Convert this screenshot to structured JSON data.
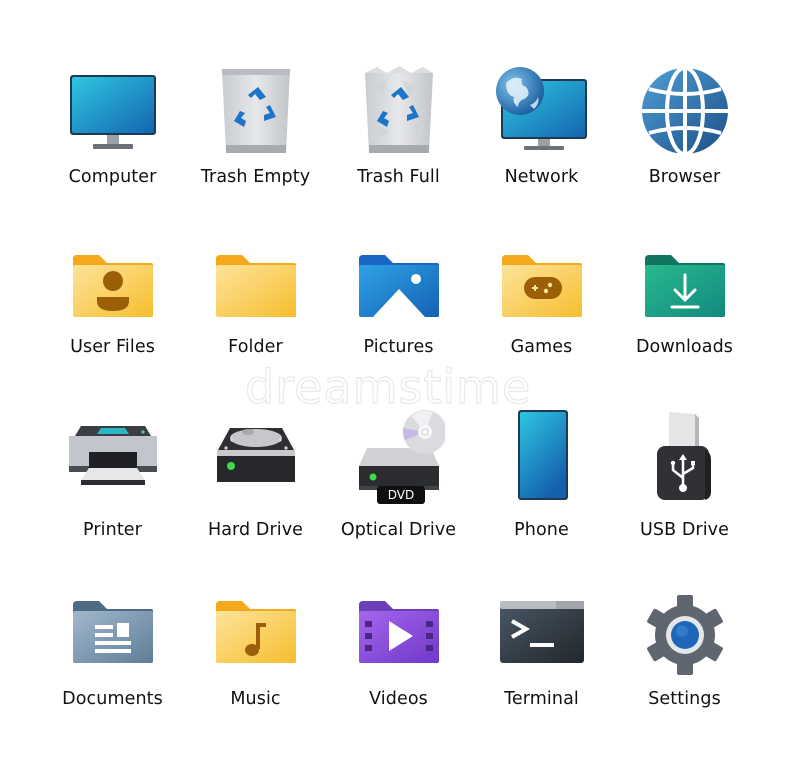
{
  "icons": [
    {
      "label": "Computer",
      "icon": "computer-icon"
    },
    {
      "label": "Trash Empty",
      "icon": "trash-empty-icon"
    },
    {
      "label": "Trash Full",
      "icon": "trash-full-icon"
    },
    {
      "label": "Network",
      "icon": "network-icon"
    },
    {
      "label": "Browser",
      "icon": "browser-icon"
    },
    {
      "label": "User Files",
      "icon": "user-files-folder-icon"
    },
    {
      "label": "Folder",
      "icon": "folder-icon"
    },
    {
      "label": "Pictures",
      "icon": "pictures-folder-icon"
    },
    {
      "label": "Games",
      "icon": "games-folder-icon"
    },
    {
      "label": "Downloads",
      "icon": "downloads-folder-icon"
    },
    {
      "label": "Printer",
      "icon": "printer-icon"
    },
    {
      "label": "Hard Drive",
      "icon": "hard-drive-icon"
    },
    {
      "label": "Optical Drive",
      "icon": "optical-drive-icon",
      "badge": "DVD"
    },
    {
      "label": "Phone",
      "icon": "phone-icon"
    },
    {
      "label": "USB Drive",
      "icon": "usb-drive-icon"
    },
    {
      "label": "Documents",
      "icon": "documents-folder-icon"
    },
    {
      "label": "Music",
      "icon": "music-folder-icon"
    },
    {
      "label": "Videos",
      "icon": "videos-folder-icon"
    },
    {
      "label": "Terminal",
      "icon": "terminal-icon"
    },
    {
      "label": "Settings",
      "icon": "settings-icon"
    }
  ],
  "watermark": "dreamstime",
  "colors": {
    "folder_yellow": "#f9c846",
    "folder_tab_yellow": "#f4a91d",
    "blue_screen": "#2196d3",
    "downloads_teal": "#1aa08a",
    "documents_slate": "#6b88a4",
    "videos_purple": "#8a4fd8",
    "led_green": "#3ddc48",
    "settings_gray": "#5f6670",
    "settings_blue": "#1f66b8"
  }
}
